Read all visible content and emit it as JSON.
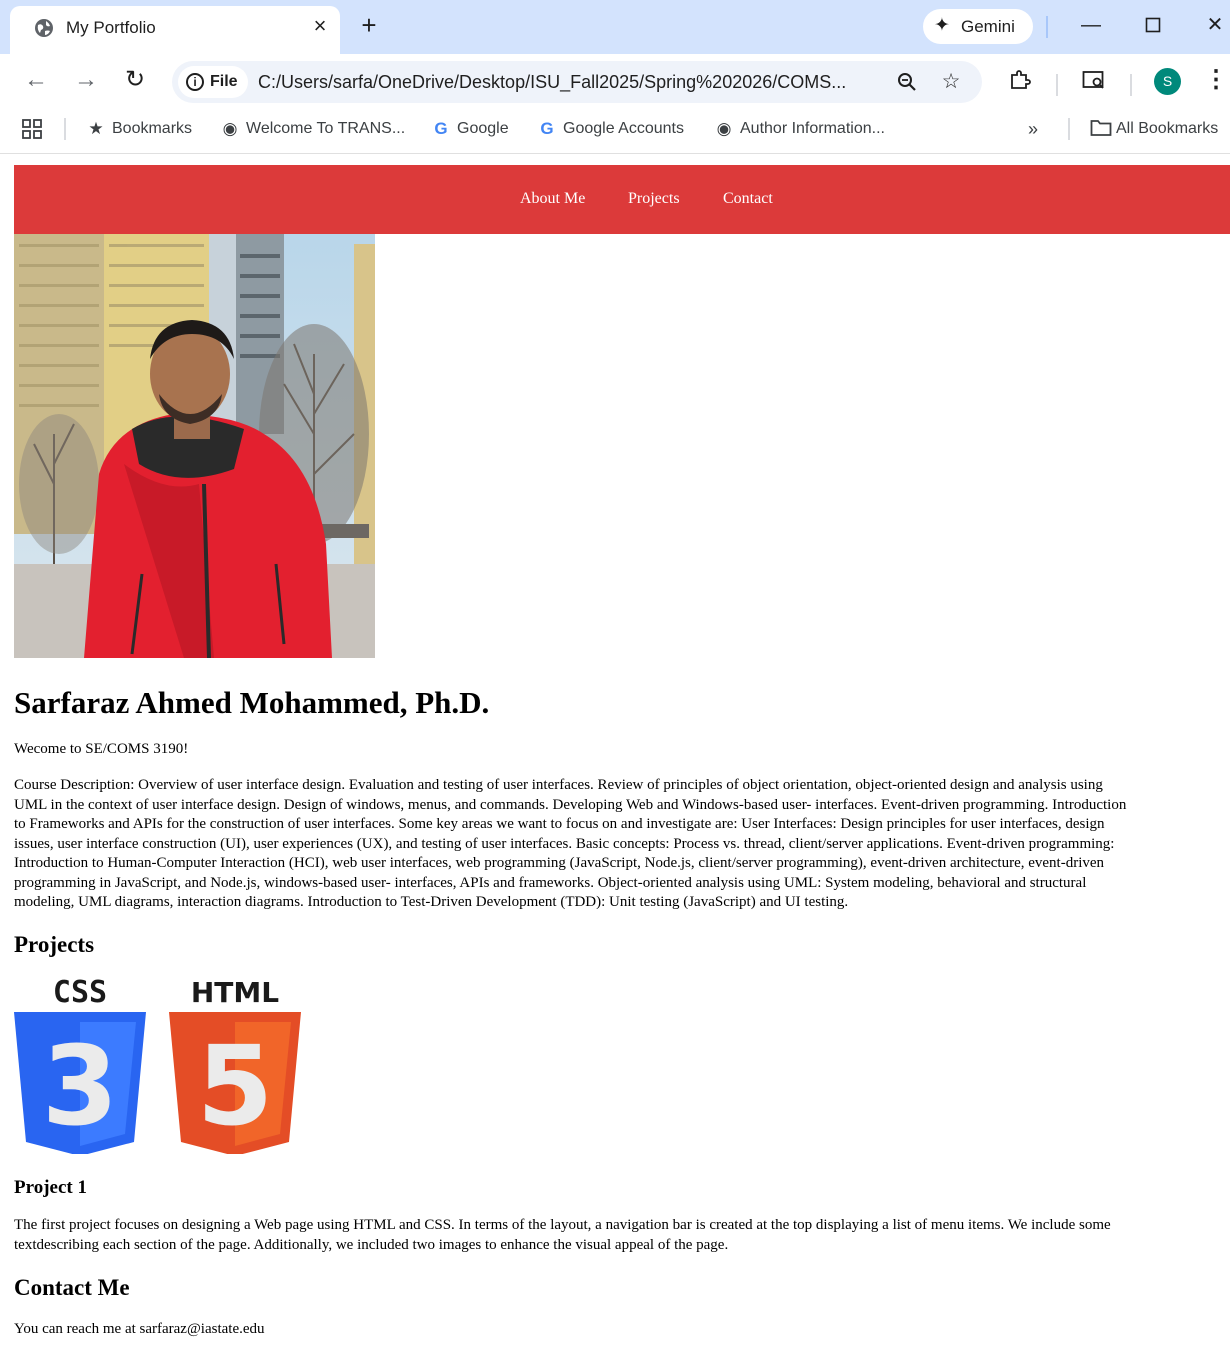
{
  "browser": {
    "tab_title": "My Portfolio",
    "tab_close_icon": "close-icon",
    "new_tab_icon": "plus-icon",
    "gemini_label": "Gemini",
    "site_chip_label": "File",
    "url": "C:/Users/sarfa/OneDrive/Desktop/ISU_Fall2025/Spring%202026/COMS...",
    "avatar_letter": "S",
    "bookmarks": [
      {
        "label": "Bookmarks",
        "icon": "star-icon"
      },
      {
        "label": "Welcome To TRANS...",
        "icon": "globe-icon"
      },
      {
        "label": "Google",
        "icon": "google-icon"
      },
      {
        "label": "Google Accounts",
        "icon": "google-icon"
      },
      {
        "label": "Author Information...",
        "icon": "globe-icon"
      }
    ],
    "all_bookmarks_label": "All Bookmarks",
    "overflow_label": "»"
  },
  "nav": {
    "items": [
      "About Me",
      "Projects",
      "Contact"
    ]
  },
  "colors": {
    "navbar": "#dc3a3a",
    "tabbar": "#d3e3fd",
    "css_logo": "#2965f1",
    "html_logo": "#e44d26"
  },
  "profile": {
    "name": "Sarfaraz Ahmed Mohammed, Ph.D.",
    "welcome": "Wecome to SE/COMS 3190!",
    "course_lines": [
      "Course Description: Overview of user interface design. Evaluation and testing of user interfaces. Review of principles of object orientation, object-oriented design and analysis using",
      "UML in the context of user interface design. Design of windows, menus, and commands. Developing Web and Windows-based user- interfaces. Event-driven programming. Introduction",
      "to Frameworks and APIs for the construction of user interfaces. Some key areas we want to focus on and investigate are: User Interfaces: Design principles for user interfaces, design",
      "issues, user interface construction (UI), user experiences (UX), and testing of user interfaces. Basic concepts: Process vs. thread, client/server applications. Event-driven programming:",
      "Introduction to Human-Computer Interaction (HCI), web user interfaces, web programming (JavaScript, Node.js, client/server programming), event-driven architecture, event-driven",
      "programming in JavaScript, and Node.js, windows-based user- interfaces, APIs and frameworks. Object-oriented analysis using UML: System modeling, behavioral and structural",
      "modeling, UML diagrams, interaction diagrams. Introduction to Test-Driven Development (TDD): Unit testing (JavaScript) and UI testing."
    ]
  },
  "projects": {
    "heading": "Projects",
    "css_logo_text": "CSS",
    "css_logo_number": "3",
    "html_logo_text": "HTML",
    "html_logo_number": "5",
    "project1_title": "Project 1",
    "project1_lines": [
      "The first project focuses on designing a Web page using HTML and CSS. In terms of the layout, a navigation bar is created at the top displaying a list of menu items. We include some",
      "textdescribing each section of the page. Additionally, we included two images to enhance the visual appeal of the page."
    ]
  },
  "contact": {
    "heading": "Contact Me",
    "text": "You can reach me at sarfaraz@iastate.edu"
  }
}
